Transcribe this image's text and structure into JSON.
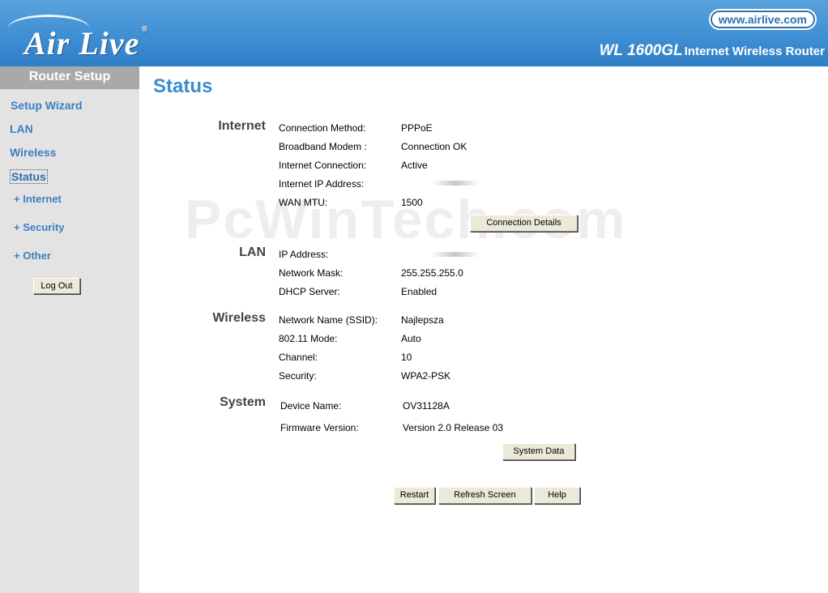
{
  "header": {
    "logo_text": "Air Live",
    "logo_mark": "®",
    "url": "www.airlive.com",
    "model": "WL 1600GL",
    "product_desc": "Internet Wireless Router"
  },
  "sidebar": {
    "title": "Router Setup",
    "items": {
      "setup_wizard": "Setup Wizard",
      "lan": "LAN",
      "wireless": "Wireless",
      "status": "Status",
      "internet": "+ Internet",
      "security": "+ Security",
      "other": "+ Other"
    },
    "logout": "Log Out"
  },
  "page": {
    "title": "Status"
  },
  "internet": {
    "heading": "Internet",
    "connection_method_label": "Connection Method:",
    "connection_method": "PPPoE",
    "modem_label": "Broadband Modem :",
    "modem": "Connection OK",
    "connection_label": "Internet Connection:",
    "connection": "Active",
    "ip_label": "Internet IP Address:",
    "mtu_label": "WAN MTU:",
    "mtu": "1500",
    "details_button": "Connection Details"
  },
  "lan": {
    "heading": "LAN",
    "ip_label": "IP Address:",
    "mask_label": "Network Mask:",
    "mask": "255.255.255.0",
    "dhcp_label": "DHCP Server:",
    "dhcp": "Enabled"
  },
  "wireless": {
    "heading": "Wireless",
    "ssid_label": "Network Name (SSID):",
    "ssid": "Najlepsza",
    "mode_label": "802.11 Mode:",
    "mode": "Auto",
    "channel_label": "Channel:",
    "channel": "10",
    "security_label": "Security:",
    "security": "WPA2-PSK"
  },
  "system": {
    "heading": "System",
    "device_label": "Device Name:",
    "device": "OV31128A",
    "firmware_label": "Firmware Version:",
    "firmware": "Version 2.0 Release 03",
    "data_button": "System Data"
  },
  "actions": {
    "restart": "Restart",
    "refresh": "Refresh Screen",
    "help": "Help"
  },
  "watermark": "PcWinTech.com"
}
